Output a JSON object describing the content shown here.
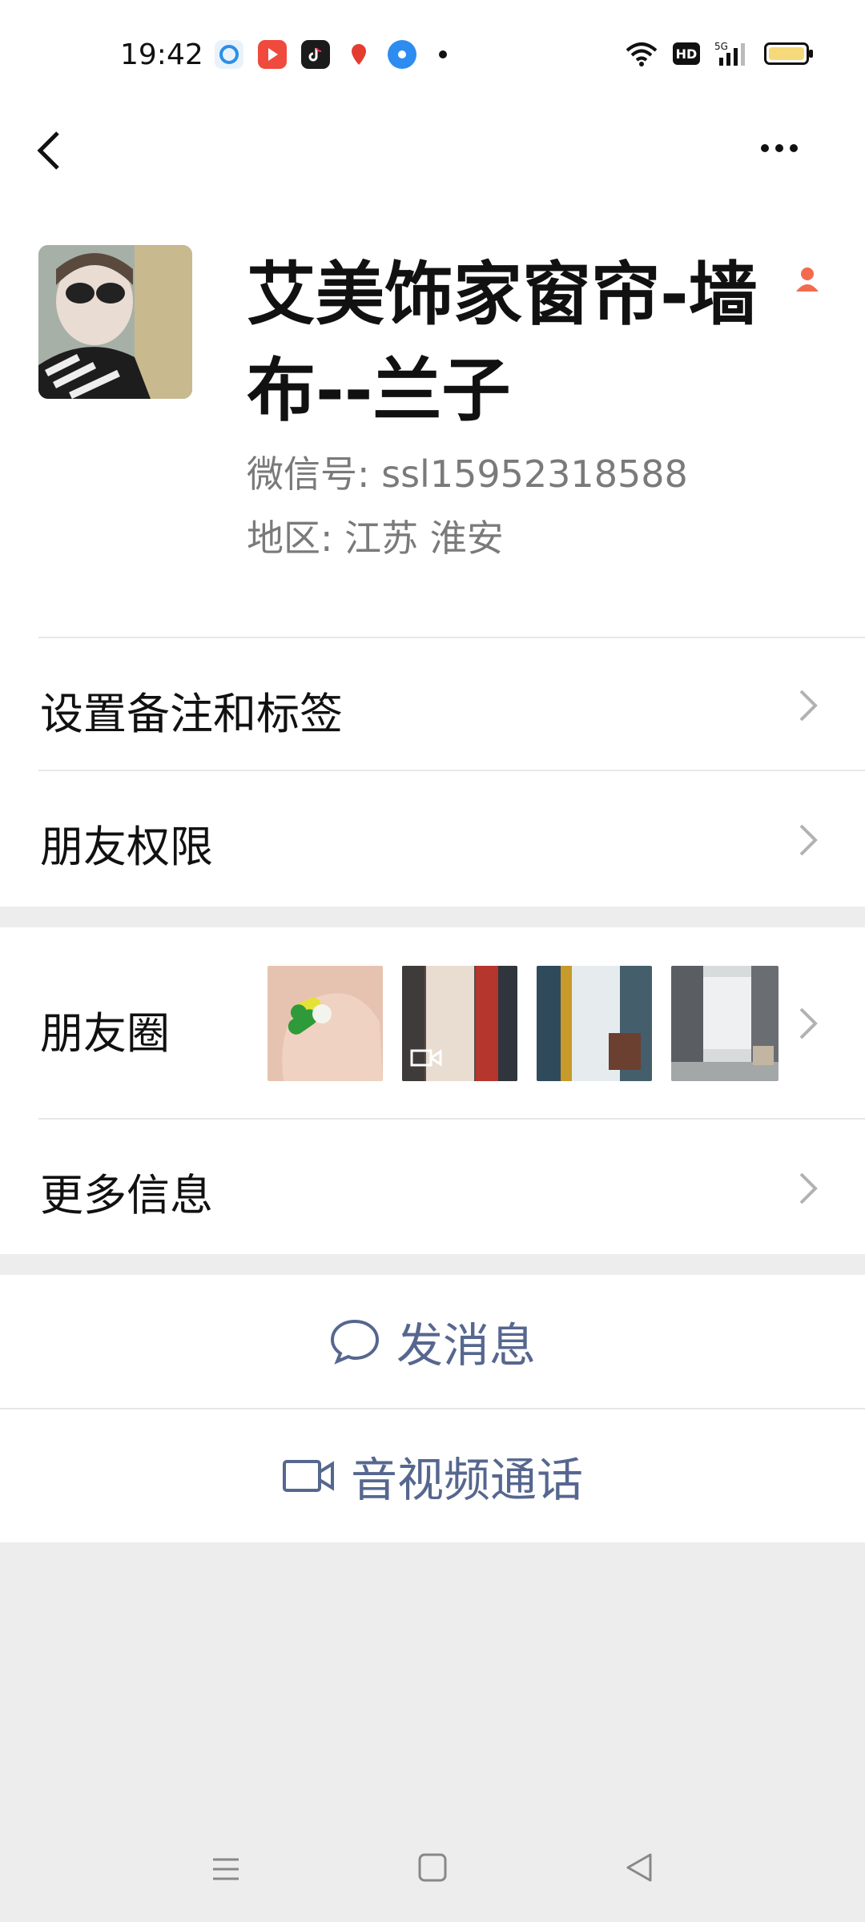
{
  "status_bar": {
    "time": "19:42",
    "app_icons": [
      "browser-icon",
      "video-app-icon",
      "tiktok-icon",
      "baidu-map-icon",
      "circle-app-icon"
    ],
    "hd_label": "HD",
    "network": "5G"
  },
  "header": {
    "back_icon": "chevron-left-icon",
    "more_icon": "more-dots-icon"
  },
  "profile": {
    "name": "艾美饰家窗帘-墙布--兰子",
    "wechat_id": "微信号: ssl15952318588",
    "region": "地区: 江苏  淮安",
    "gender_color": "#f26b4f"
  },
  "menu": {
    "remark_tags": "设置备注和标签",
    "friend_permissions": "朋友权限",
    "moments": "朋友圈",
    "more_info": "更多信息"
  },
  "actions": {
    "send_message": "发消息",
    "av_call": "音视频通话"
  },
  "colors": {
    "accent": "#56678f",
    "background": "#ededed"
  }
}
